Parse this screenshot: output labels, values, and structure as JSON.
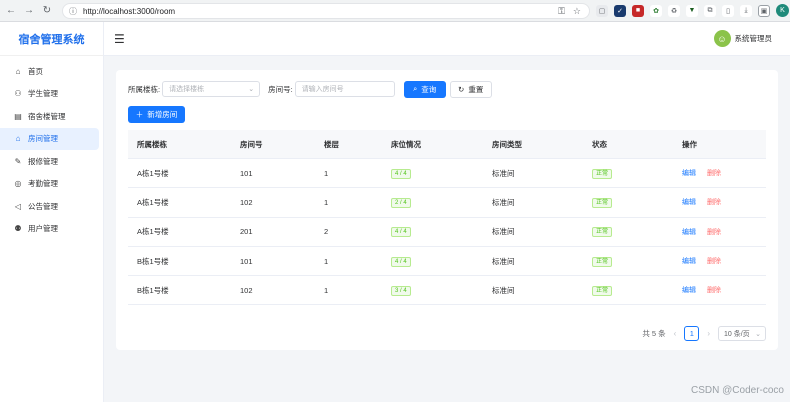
{
  "browser": {
    "url": "http://localhost:3000/room",
    "profile_initial": "K"
  },
  "app": {
    "brand": "宿舍管理系统",
    "user_name": "系统管理员"
  },
  "sidebar": {
    "items": [
      {
        "label": "首页",
        "icon": "home-icon"
      },
      {
        "label": "学生管理",
        "icon": "user-icon"
      },
      {
        "label": "宿舍楼管理",
        "icon": "building-icon"
      },
      {
        "label": "房间管理",
        "icon": "home-icon",
        "active": true
      },
      {
        "label": "报修管理",
        "icon": "wrench-icon"
      },
      {
        "label": "考勤管理",
        "icon": "check-circle-icon"
      },
      {
        "label": "公告管理",
        "icon": "megaphone-icon"
      },
      {
        "label": "用户管理",
        "icon": "users-icon"
      }
    ]
  },
  "search": {
    "building_label": "所属楼栋:",
    "building_placeholder": "请选择楼栋",
    "room_label": "房间号:",
    "room_placeholder": "请输入房间号",
    "query_label": "查询",
    "reset_label": "重置",
    "add_label": "新增房间"
  },
  "table": {
    "headers": [
      "所属楼栋",
      "房间号",
      "楼层",
      "床位情况",
      "房间类型",
      "状态",
      "操作"
    ],
    "rows": [
      {
        "building": "A栋1号楼",
        "room": "101",
        "floor": "1",
        "beds": "4 / 4",
        "type": "标准间",
        "status": "正常",
        "edit": "编辑",
        "del": "删除"
      },
      {
        "building": "A栋1号楼",
        "room": "102",
        "floor": "1",
        "beds": "2 / 4",
        "type": "标准间",
        "status": "正常",
        "edit": "编辑",
        "del": "删除"
      },
      {
        "building": "A栋1号楼",
        "room": "201",
        "floor": "2",
        "beds": "4 / 4",
        "type": "标准间",
        "status": "正常",
        "edit": "编辑",
        "del": "删除"
      },
      {
        "building": "B栋1号楼",
        "room": "101",
        "floor": "1",
        "beds": "4 / 4",
        "type": "标准间",
        "status": "正常",
        "edit": "编辑",
        "del": "删除"
      },
      {
        "building": "B栋1号楼",
        "room": "102",
        "floor": "1",
        "beds": "3 / 4",
        "type": "标准间",
        "status": "正常",
        "edit": "编辑",
        "del": "删除"
      }
    ]
  },
  "pagination": {
    "total": "共 5 条",
    "current_page": "1",
    "page_size": "10 条/页"
  },
  "watermark": "CSDN @Coder-coco",
  "colors": {
    "primary": "#1677ff",
    "success": "#52c41a",
    "danger": "#ff6b6b"
  }
}
